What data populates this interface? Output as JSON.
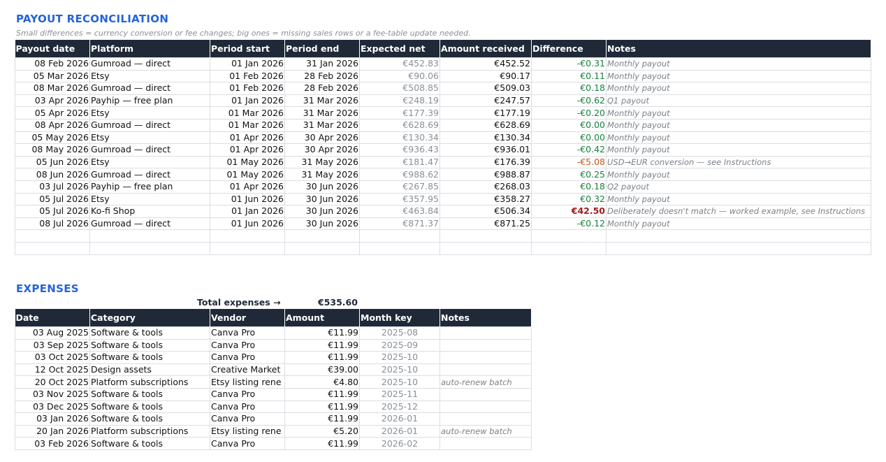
{
  "payout": {
    "title": "PAYOUT RECONCILIATION",
    "subtitle": "Small differences = currency conversion or fee changes; big ones = missing sales rows or a fee-table update needed.",
    "headers": [
      "Payout date",
      "Platform",
      "Period start",
      "Period end",
      "Expected net",
      "Amount received",
      "Difference",
      "Notes"
    ],
    "rows": [
      {
        "date": "08 Feb 2026",
        "platform": "Gumroad — direct",
        "start": "01 Jan 2026",
        "end": "31 Jan 2026",
        "expected": "€452.83",
        "received": "€452.52",
        "diff": "-€0.31",
        "status": "ok",
        "notes": "Monthly payout"
      },
      {
        "date": "05 Mar 2026",
        "platform": "Etsy",
        "start": "01 Feb 2026",
        "end": "28 Feb 2026",
        "expected": "€90.06",
        "received": "€90.17",
        "diff": "€0.11",
        "status": "ok",
        "notes": "Monthly payout"
      },
      {
        "date": "08 Mar 2026",
        "platform": "Gumroad — direct",
        "start": "01 Feb 2026",
        "end": "28 Feb 2026",
        "expected": "€508.85",
        "received": "€509.03",
        "diff": "€0.18",
        "status": "ok",
        "notes": "Monthly payout"
      },
      {
        "date": "03 Apr 2026",
        "platform": "Payhip — free plan",
        "start": "01 Jan 2026",
        "end": "31 Mar 2026",
        "expected": "€248.19",
        "received": "€247.57",
        "diff": "-€0.62",
        "status": "ok",
        "notes": "Q1 payout"
      },
      {
        "date": "05 Apr 2026",
        "platform": "Etsy",
        "start": "01 Mar 2026",
        "end": "31 Mar 2026",
        "expected": "€177.39",
        "received": "€177.19",
        "diff": "-€0.20",
        "status": "ok",
        "notes": "Monthly payout"
      },
      {
        "date": "08 Apr 2026",
        "platform": "Gumroad — direct",
        "start": "01 Mar 2026",
        "end": "31 Mar 2026",
        "expected": "€628.69",
        "received": "€628.69",
        "diff": "€0.00",
        "status": "ok",
        "notes": "Monthly payout"
      },
      {
        "date": "05 May 2026",
        "platform": "Etsy",
        "start": "01 Apr 2026",
        "end": "30 Apr 2026",
        "expected": "€130.34",
        "received": "€130.34",
        "diff": "€0.00",
        "status": "ok",
        "notes": "Monthly payout"
      },
      {
        "date": "08 May 2026",
        "platform": "Gumroad — direct",
        "start": "01 Apr 2026",
        "end": "30 Apr 2026",
        "expected": "€936.43",
        "received": "€936.01",
        "diff": "-€0.42",
        "status": "ok",
        "notes": "Monthly payout"
      },
      {
        "date": "05 Jun 2026",
        "platform": "Etsy",
        "start": "01 May 2026",
        "end": "31 May 2026",
        "expected": "€181.47",
        "received": "€176.39",
        "diff": "-€5.08",
        "status": "warn",
        "notes": "USD→EUR conversion — see Instructions"
      },
      {
        "date": "08 Jun 2026",
        "platform": "Gumroad — direct",
        "start": "01 May 2026",
        "end": "31 May 2026",
        "expected": "€988.62",
        "received": "€988.87",
        "diff": "€0.25",
        "status": "ok",
        "notes": "Monthly payout"
      },
      {
        "date": "03 Jul 2026",
        "platform": "Payhip — free plan",
        "start": "01 Apr 2026",
        "end": "30 Jun 2026",
        "expected": "€267.85",
        "received": "€268.03",
        "diff": "€0.18",
        "status": "ok",
        "notes": "Q2 payout"
      },
      {
        "date": "05 Jul 2026",
        "platform": "Etsy",
        "start": "01 Jun 2026",
        "end": "30 Jun 2026",
        "expected": "€357.95",
        "received": "€358.27",
        "diff": "€0.32",
        "status": "ok",
        "notes": "Monthly payout"
      },
      {
        "date": "05 Jul 2026",
        "platform": "Ko-fi Shop",
        "start": "01 Jan 2026",
        "end": "30 Jun 2026",
        "expected": "€463.84",
        "received": "€506.34",
        "diff": "€42.50",
        "status": "bad",
        "notes": "Deliberately doesn't match — worked example, see Instructions"
      },
      {
        "date": "08 Jul 2026",
        "platform": "Gumroad — direct",
        "start": "01 Jun 2026",
        "end": "30 Jun 2026",
        "expected": "€871.37",
        "received": "€871.25",
        "diff": "-€0.12",
        "status": "ok",
        "notes": "Monthly payout"
      }
    ],
    "empty_rows": 2,
    "colors": {
      "ok": "#16803c",
      "warn": "#c2561c",
      "bad": "#a61b1b",
      "header": "#1f2937",
      "accent": "#2563d9"
    }
  },
  "expenses": {
    "title": "EXPENSES",
    "total_label": "Total expenses →",
    "total_value": "€535.60",
    "headers": [
      "Date",
      "Category",
      "Vendor",
      "Amount",
      "Month key",
      "Notes"
    ],
    "rows": [
      {
        "date": "03 Aug 2025",
        "category": "Software & tools",
        "vendor": "Canva Pro",
        "amount": "€11.99",
        "month": "2025-08",
        "notes": ""
      },
      {
        "date": "03 Sep 2025",
        "category": "Software & tools",
        "vendor": "Canva Pro",
        "amount": "€11.99",
        "month": "2025-09",
        "notes": ""
      },
      {
        "date": "03 Oct 2025",
        "category": "Software & tools",
        "vendor": "Canva Pro",
        "amount": "€11.99",
        "month": "2025-10",
        "notes": ""
      },
      {
        "date": "12 Oct 2025",
        "category": "Design assets",
        "vendor": "Creative Market",
        "amount": "€39.00",
        "month": "2025-10",
        "notes": ""
      },
      {
        "date": "20 Oct 2025",
        "category": "Platform subscriptions",
        "vendor": "Etsy listing rene",
        "amount": "€4.80",
        "month": "2025-10",
        "notes": "auto-renew batch"
      },
      {
        "date": "03 Nov 2025",
        "category": "Software & tools",
        "vendor": "Canva Pro",
        "amount": "€11.99",
        "month": "2025-11",
        "notes": ""
      },
      {
        "date": "03 Dec 2025",
        "category": "Software & tools",
        "vendor": "Canva Pro",
        "amount": "€11.99",
        "month": "2025-12",
        "notes": ""
      },
      {
        "date": "03 Jan 2026",
        "category": "Software & tools",
        "vendor": "Canva Pro",
        "amount": "€11.99",
        "month": "2026-01",
        "notes": ""
      },
      {
        "date": "20 Jan 2026",
        "category": "Platform subscriptions",
        "vendor": "Etsy listing rene",
        "amount": "€5.20",
        "month": "2026-01",
        "notes": "auto-renew batch"
      },
      {
        "date": "03 Feb 2026",
        "category": "Software & tools",
        "vendor": "Canva Pro",
        "amount": "€11.99",
        "month": "2026-02",
        "notes": ""
      }
    ]
  }
}
